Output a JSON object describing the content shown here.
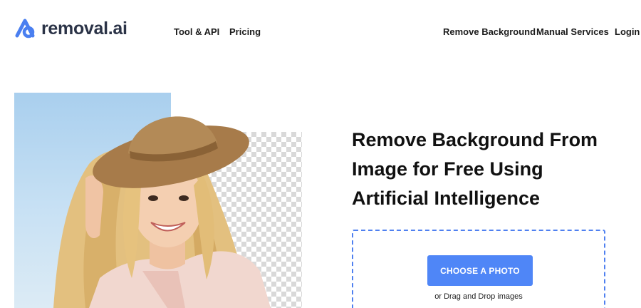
{
  "header": {
    "logo_text": "removal.ai",
    "nav_left": [
      "Tool & API",
      "Pricing"
    ],
    "nav_right": [
      "Remove Background",
      "Manual Services",
      "Login"
    ]
  },
  "hero": {
    "headline_lines": [
      "Remove Background From",
      "Image for Free Using",
      "Artificial Intelligence"
    ],
    "upload": {
      "button_label": "CHOOSE A PHOTO",
      "hint": "or Drag and Drop images"
    }
  },
  "colors": {
    "accent": "#4f86f7",
    "logo_blue": "#4a7ff0",
    "text": "#111111"
  }
}
